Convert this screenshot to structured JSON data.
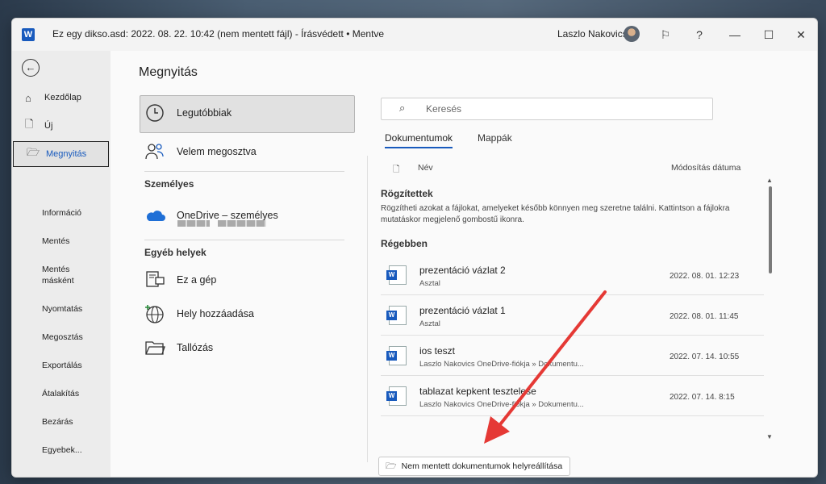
{
  "titlebar": {
    "app_icon_letter": "W",
    "title": "Ez egy dikso.asd: 2022. 08. 22. 10:42 (nem mentett fájl)  -  Írásvédett • Mentve",
    "user_name": "Laszlo Nakovics",
    "controls": {
      "feedback": "⚐",
      "help": "?",
      "minimize": "—",
      "maximize": "☐",
      "close": "✕"
    }
  },
  "sidebar": {
    "back_icon": "←",
    "primary": [
      {
        "label": "Kezdőlap",
        "icon": "⌂"
      },
      {
        "label": "Új",
        "icon": "🗋"
      },
      {
        "label": "Megnyitás",
        "icon": "🗁"
      }
    ],
    "secondary": [
      "Információ",
      "Mentés",
      "Mentés",
      "másként",
      "Nyomtatás",
      "Megosztás",
      "Exportálás",
      "Átalakítás",
      "Bezárás",
      "Egyebek..."
    ]
  },
  "main": {
    "title": "Megnyitás",
    "locations": {
      "recent": "Legutóbbiak",
      "shared": "Velem megosztva",
      "personal_header": "Személyes",
      "onedrive": "OneDrive – személyes",
      "other_header": "Egyéb helyek",
      "this_pc": "Ez a gép",
      "add_place": "Hely hozzáadása",
      "browse": "Tallózás"
    },
    "search_placeholder": "Keresés",
    "tabs": [
      "Dokumentumok",
      "Mappák"
    ],
    "columns": {
      "name": "Név",
      "modified": "Módosítás dátuma"
    },
    "pinned_header": "Rögzítettek",
    "pinned_desc": "Rögzítheti azokat a fájlokat, amelyeket később könnyen meg szeretne találni. Kattintson a fájlokra mutatáskor megjelenő gombostű ikonra.",
    "older_header": "Régebben",
    "files": [
      {
        "name": "prezentáció vázlat 2",
        "location": "Asztal",
        "date": "2022. 08. 01. 12:23"
      },
      {
        "name": "prezentáció vázlat 1",
        "location": "Asztal",
        "date": "2022. 08. 01. 11:45"
      },
      {
        "name": "ios teszt",
        "location": "Laszlo Nakovics OneDrive-fiókja » Dokumentu...",
        "date": "2022. 07. 14. 10:55"
      },
      {
        "name": "tablazat kepkent tesztelese",
        "location": "Laszlo Nakovics OneDrive-fiókja » Dokumentu...",
        "date": "2022. 07. 14. 8:15"
      }
    ],
    "recover_button": "Nem mentett dokumentumok helyreállítása"
  },
  "colors": {
    "accent": "#185abd",
    "annotation_arrow": "#e53935"
  }
}
